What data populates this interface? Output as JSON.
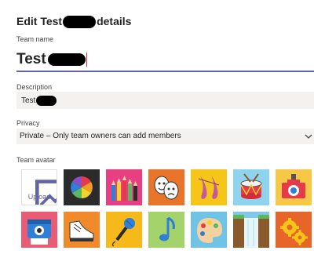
{
  "dialog": {
    "title_prefix": "Edit Test",
    "title_suffix": "details"
  },
  "team_name": {
    "label": "Team name",
    "value": "Test"
  },
  "description": {
    "label": "Description",
    "value": "Test"
  },
  "privacy": {
    "label": "Privacy",
    "selected": "Private – Only team owners can add members"
  },
  "avatar": {
    "label": "Team avatar",
    "upload_label": "Upload",
    "options": [
      {
        "name": "color-wheel-icon",
        "bg": "#2b2b2b"
      },
      {
        "name": "pencils-icon",
        "bg": "#e83f83"
      },
      {
        "name": "theater-masks-icon",
        "bg": "#e8752a"
      },
      {
        "name": "ballet-shoes-icon",
        "bg": "#f5c518"
      },
      {
        "name": "drum-icon",
        "bg": "#8fd4ee"
      },
      {
        "name": "camera-icon",
        "bg": "#f7c845"
      },
      {
        "name": "instant-camera-icon",
        "bg": "#e85d75"
      },
      {
        "name": "sneaker-icon",
        "bg": "#f08a2a"
      },
      {
        "name": "microphone-icon",
        "bg": "#f6b919"
      },
      {
        "name": "music-note-icon",
        "bg": "#a4d36b"
      },
      {
        "name": "paint-palette-icon",
        "bg": "#6fc3e6"
      },
      {
        "name": "waterfall-icon",
        "bg": "#7fc8e8"
      },
      {
        "name": "gears-icon",
        "bg": "#e8652a"
      }
    ]
  },
  "colors": {
    "accent": "#6264a7",
    "field_bg": "#f3f2f1"
  }
}
